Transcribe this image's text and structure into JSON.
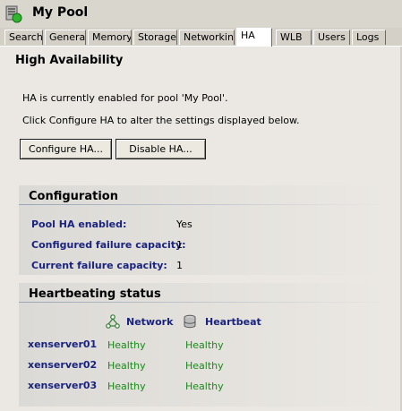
{
  "header": {
    "title": "My Pool",
    "icon": "pool-icon"
  },
  "tabs": [
    {
      "label": "Search",
      "active": false
    },
    {
      "label": "General",
      "active": false
    },
    {
      "label": "Memory",
      "active": false
    },
    {
      "label": "Storage",
      "active": false
    },
    {
      "label": "Networking",
      "active": false
    },
    {
      "label": "HA",
      "active": true
    },
    {
      "label": "WLB",
      "active": false
    },
    {
      "label": "Users",
      "active": false
    },
    {
      "label": "Logs",
      "active": false
    }
  ],
  "page": {
    "title": "High Availability",
    "status_text": "HA is currently enabled for pool 'My Pool'.",
    "hint_text": "Click Configure HA to alter the settings displayed below.",
    "configure_button": "Configure HA...",
    "disable_button": "Disable HA..."
  },
  "configuration": {
    "heading": "Configuration",
    "rows": [
      {
        "label": "Pool HA enabled:",
        "value": "Yes"
      },
      {
        "label": "Configured failure capacity:",
        "value": "1"
      },
      {
        "label": "Current failure capacity:",
        "value": "1"
      }
    ]
  },
  "heartbeating": {
    "heading": "Heartbeating status",
    "columns": {
      "network": "Network",
      "heartbeat": "Heartbeat"
    },
    "servers": [
      {
        "name": "xenserver01",
        "network": "Healthy",
        "heartbeat": "Healthy"
      },
      {
        "name": "xenserver02",
        "network": "Healthy",
        "heartbeat": "Healthy"
      },
      {
        "name": "xenserver03",
        "network": "Healthy",
        "heartbeat": "Healthy"
      }
    ]
  },
  "colors": {
    "label_blue": "#1a237e",
    "healthy_green": "#1a8a1a",
    "content_bg": "#ebe8e3"
  }
}
